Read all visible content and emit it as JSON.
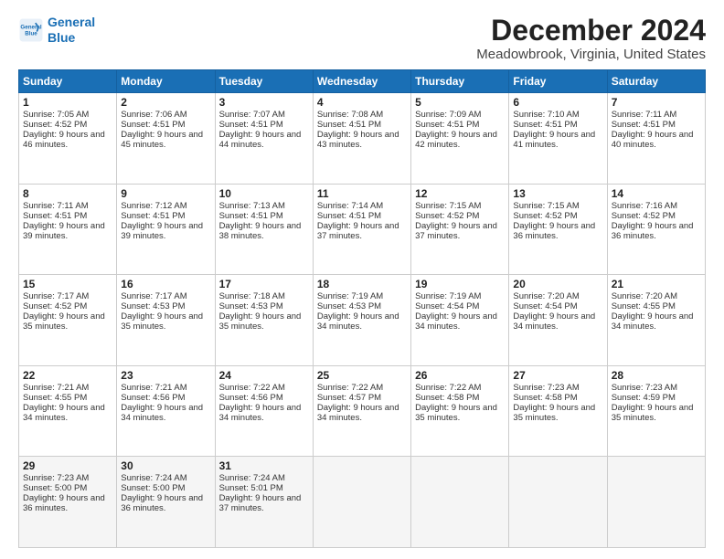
{
  "logo": {
    "line1": "General",
    "line2": "Blue"
  },
  "title": "December 2024",
  "subtitle": "Meadowbrook, Virginia, United States",
  "days_header": [
    "Sunday",
    "Monday",
    "Tuesday",
    "Wednesday",
    "Thursday",
    "Friday",
    "Saturday"
  ],
  "weeks": [
    [
      {
        "day": "1",
        "sunrise": "7:05 AM",
        "sunset": "4:52 PM",
        "daylight": "9 hours and 46 minutes."
      },
      {
        "day": "2",
        "sunrise": "7:06 AM",
        "sunset": "4:51 PM",
        "daylight": "9 hours and 45 minutes."
      },
      {
        "day": "3",
        "sunrise": "7:07 AM",
        "sunset": "4:51 PM",
        "daylight": "9 hours and 44 minutes."
      },
      {
        "day": "4",
        "sunrise": "7:08 AM",
        "sunset": "4:51 PM",
        "daylight": "9 hours and 43 minutes."
      },
      {
        "day": "5",
        "sunrise": "7:09 AM",
        "sunset": "4:51 PM",
        "daylight": "9 hours and 42 minutes."
      },
      {
        "day": "6",
        "sunrise": "7:10 AM",
        "sunset": "4:51 PM",
        "daylight": "9 hours and 41 minutes."
      },
      {
        "day": "7",
        "sunrise": "7:11 AM",
        "sunset": "4:51 PM",
        "daylight": "9 hours and 40 minutes."
      }
    ],
    [
      {
        "day": "8",
        "sunrise": "7:11 AM",
        "sunset": "4:51 PM",
        "daylight": "9 hours and 39 minutes."
      },
      {
        "day": "9",
        "sunrise": "7:12 AM",
        "sunset": "4:51 PM",
        "daylight": "9 hours and 39 minutes."
      },
      {
        "day": "10",
        "sunrise": "7:13 AM",
        "sunset": "4:51 PM",
        "daylight": "9 hours and 38 minutes."
      },
      {
        "day": "11",
        "sunrise": "7:14 AM",
        "sunset": "4:51 PM",
        "daylight": "9 hours and 37 minutes."
      },
      {
        "day": "12",
        "sunrise": "7:15 AM",
        "sunset": "4:52 PM",
        "daylight": "9 hours and 37 minutes."
      },
      {
        "day": "13",
        "sunrise": "7:15 AM",
        "sunset": "4:52 PM",
        "daylight": "9 hours and 36 minutes."
      },
      {
        "day": "14",
        "sunrise": "7:16 AM",
        "sunset": "4:52 PM",
        "daylight": "9 hours and 36 minutes."
      }
    ],
    [
      {
        "day": "15",
        "sunrise": "7:17 AM",
        "sunset": "4:52 PM",
        "daylight": "9 hours and 35 minutes."
      },
      {
        "day": "16",
        "sunrise": "7:17 AM",
        "sunset": "4:53 PM",
        "daylight": "9 hours and 35 minutes."
      },
      {
        "day": "17",
        "sunrise": "7:18 AM",
        "sunset": "4:53 PM",
        "daylight": "9 hours and 35 minutes."
      },
      {
        "day": "18",
        "sunrise": "7:19 AM",
        "sunset": "4:53 PM",
        "daylight": "9 hours and 34 minutes."
      },
      {
        "day": "19",
        "sunrise": "7:19 AM",
        "sunset": "4:54 PM",
        "daylight": "9 hours and 34 minutes."
      },
      {
        "day": "20",
        "sunrise": "7:20 AM",
        "sunset": "4:54 PM",
        "daylight": "9 hours and 34 minutes."
      },
      {
        "day": "21",
        "sunrise": "7:20 AM",
        "sunset": "4:55 PM",
        "daylight": "9 hours and 34 minutes."
      }
    ],
    [
      {
        "day": "22",
        "sunrise": "7:21 AM",
        "sunset": "4:55 PM",
        "daylight": "9 hours and 34 minutes."
      },
      {
        "day": "23",
        "sunrise": "7:21 AM",
        "sunset": "4:56 PM",
        "daylight": "9 hours and 34 minutes."
      },
      {
        "day": "24",
        "sunrise": "7:22 AM",
        "sunset": "4:56 PM",
        "daylight": "9 hours and 34 minutes."
      },
      {
        "day": "25",
        "sunrise": "7:22 AM",
        "sunset": "4:57 PM",
        "daylight": "9 hours and 34 minutes."
      },
      {
        "day": "26",
        "sunrise": "7:22 AM",
        "sunset": "4:58 PM",
        "daylight": "9 hours and 35 minutes."
      },
      {
        "day": "27",
        "sunrise": "7:23 AM",
        "sunset": "4:58 PM",
        "daylight": "9 hours and 35 minutes."
      },
      {
        "day": "28",
        "sunrise": "7:23 AM",
        "sunset": "4:59 PM",
        "daylight": "9 hours and 35 minutes."
      }
    ],
    [
      {
        "day": "29",
        "sunrise": "7:23 AM",
        "sunset": "5:00 PM",
        "daylight": "9 hours and 36 minutes."
      },
      {
        "day": "30",
        "sunrise": "7:24 AM",
        "sunset": "5:00 PM",
        "daylight": "9 hours and 36 minutes."
      },
      {
        "day": "31",
        "sunrise": "7:24 AM",
        "sunset": "5:01 PM",
        "daylight": "9 hours and 37 minutes."
      },
      null,
      null,
      null,
      null
    ]
  ]
}
